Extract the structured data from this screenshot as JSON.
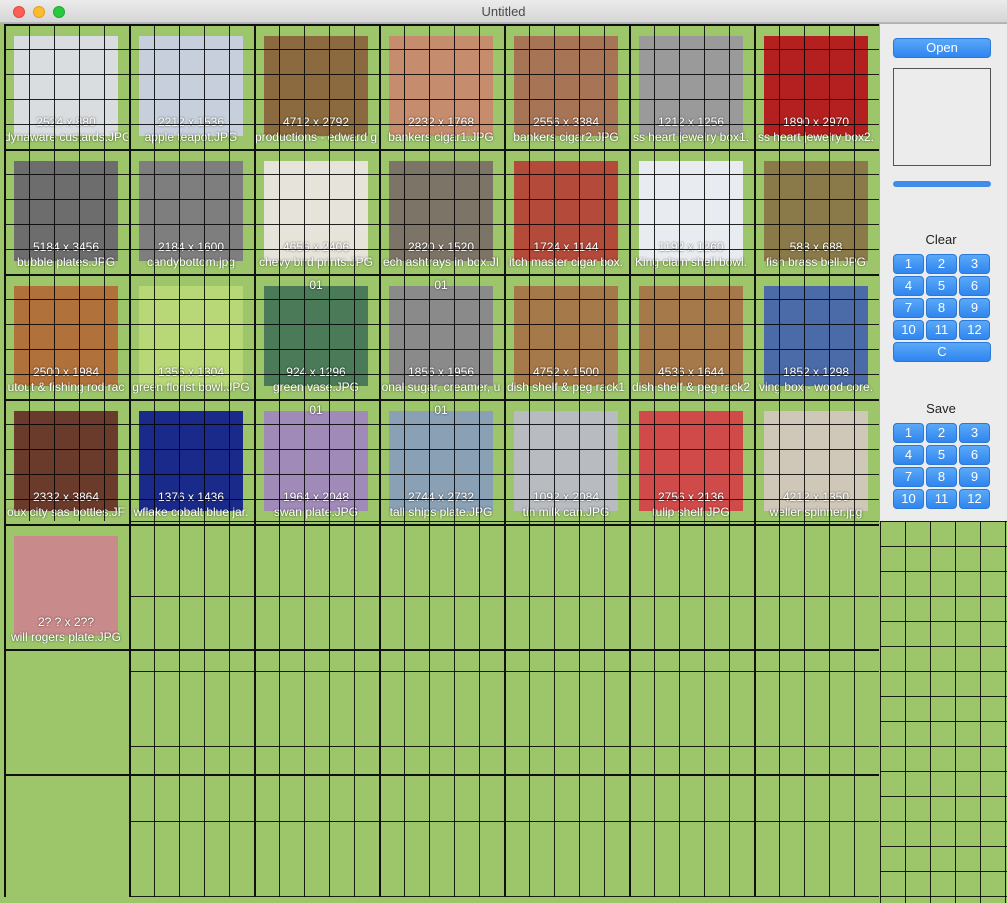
{
  "window": {
    "title": "Untitled"
  },
  "panel": {
    "open_label": "Open",
    "clear_label": "Clear",
    "save_label": "Save",
    "clear_buttons": [
      "1",
      "2",
      "3",
      "4",
      "5",
      "6",
      "7",
      "8",
      "9",
      "10",
      "11",
      "12",
      "C"
    ],
    "save_buttons": [
      "1",
      "2",
      "3",
      "4",
      "5",
      "6",
      "7",
      "8",
      "9",
      "10",
      "11",
      "12"
    ],
    "accent": "#3e8ded"
  },
  "grid_background": "#9dc56a",
  "images": [
    {
      "dims": "2524 x 880",
      "name": "dynaware custards.JPG",
      "tag": "",
      "color": "#d9dde0"
    },
    {
      "dims": "2212 x 1536",
      "name": "apple teapot.JPG",
      "tag": "",
      "color": "#c6cfdb"
    },
    {
      "dims": "4712 x 2792",
      "name": "productions - edward g",
      "tag": "",
      "color": "#8a6a3e"
    },
    {
      "dims": "2232 x 1768",
      "name": "bankers cigar1.JPG",
      "tag": "",
      "color": "#c58c6d"
    },
    {
      "dims": "2556 x 3384",
      "name": "bankers cigar2.JPG",
      "tag": "",
      "color": "#a87456"
    },
    {
      "dims": "1212 x 1256",
      "name": "ss heart jewelry box1.",
      "tag": "",
      "color": "#9a9a9a"
    },
    {
      "dims": "1890 x 2970",
      "name": "ss heart jewelry box2.",
      "tag": "",
      "color": "#b42020"
    },
    {
      "dims": "5184 x 3456",
      "name": "bubble plates.JPG",
      "tag": "",
      "color": "#6d6d6d"
    },
    {
      "dims": "2184 x 1600",
      "name": "candybottom.jpg",
      "tag": "",
      "color": "#7e7e7e"
    },
    {
      "dims": "4656 x 2406",
      "name": "chevy bird prints.JPG",
      "tag": "",
      "color": "#e6e3da"
    },
    {
      "dims": "2820 x 1520",
      "name": "ech ashtrays in box.JI",
      "tag": "",
      "color": "#7d7468"
    },
    {
      "dims": "1724 x 1144",
      "name": "itch master cigar box.",
      "tag": "",
      "color": "#b34a3a"
    },
    {
      "dims": "1192 x 1260",
      "name": "King clam shell bowl.",
      "tag": "",
      "color": "#e8ecf0"
    },
    {
      "dims": "588 x 688",
      "name": "fish brass bell.JPG",
      "tag": "",
      "color": "#8a7a4a"
    },
    {
      "dims": "2500 x 1984",
      "name": "utout & fishing rod rac",
      "tag": "",
      "color": "#b0713a"
    },
    {
      "dims": "1356 x 1304",
      "name": "green florist bowl.JPG",
      "tag": "",
      "color": "#b8d878"
    },
    {
      "dims": "924 x 1296",
      "name": "green vase.JPG",
      "tag": "01",
      "color": "#4a7a58"
    },
    {
      "dims": "1856 x 1956",
      "name": "onal sugar, creamer, u",
      "tag": "01",
      "color": "#8a8a8a"
    },
    {
      "dims": "4752 x 1500",
      "name": "dish shelf & peg rack1",
      "tag": "",
      "color": "#a5794a"
    },
    {
      "dims": "4536 x 1644",
      "name": "dish shelf & peg rack2",
      "tag": "",
      "color": "#a5794a"
    },
    {
      "dims": "1852 x 1298",
      "name": "ving box - wood core.",
      "tag": "",
      "color": "#4a6aa8"
    },
    {
      "dims": "2332 x 3864",
      "name": "oux city sas bottles.JF",
      "tag": "",
      "color": "#6a3a2a"
    },
    {
      "dims": "1376 x 1436",
      "name": "wflake cobalt blue jar.",
      "tag": "",
      "color": "#1a2a8a"
    },
    {
      "dims": "1964 x 2048",
      "name": "swan plate.JPG",
      "tag": "01",
      "color": "#a08ab8"
    },
    {
      "dims": "2744 x 2732",
      "name": "tall ships plate.JPG",
      "tag": "01",
      "color": "#8aa0b4"
    },
    {
      "dims": "1092 x 2084",
      "name": "tin milk can.JPG",
      "tag": "",
      "color": "#b8bcc0"
    },
    {
      "dims": "2756 x 2136",
      "name": "tulip shelf.JPG",
      "tag": "",
      "color": "#d04a4a"
    },
    {
      "dims": "4212 x 1350",
      "name": "weller spinner.jpg",
      "tag": "",
      "color": "#cfc8b8"
    },
    {
      "dims": "2? ? x 2?? ",
      "name": "will rogers plate.JPG",
      "tag": "",
      "color": "#c88a8a"
    }
  ]
}
